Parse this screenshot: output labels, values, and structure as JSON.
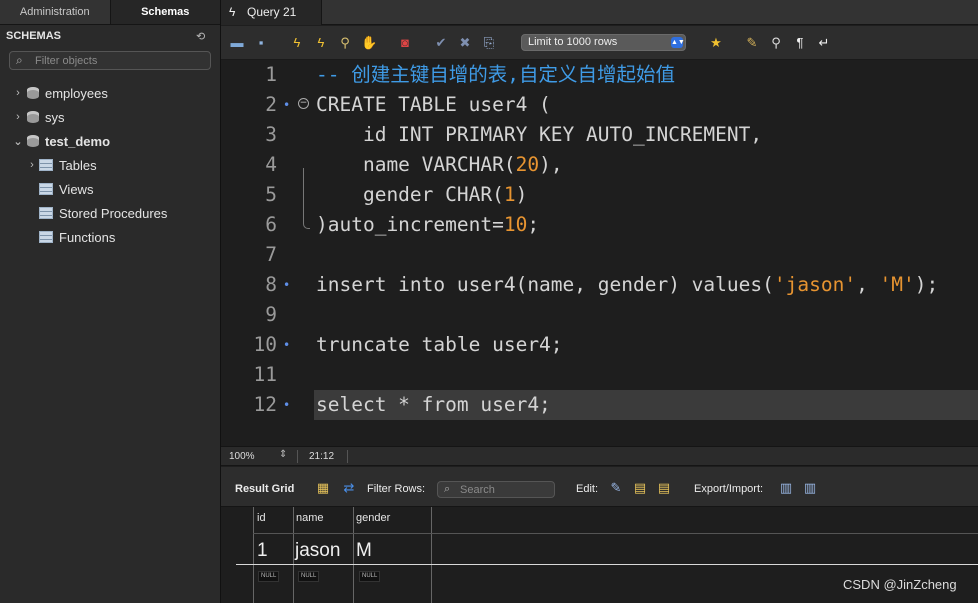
{
  "left_tabs": [
    "Administration",
    "Schemas"
  ],
  "schemas": {
    "header": "SCHEMAS",
    "filter_placeholder": "Filter objects",
    "items": [
      {
        "chevron": "›",
        "label": "employees"
      },
      {
        "chevron": "›",
        "label": "sys"
      },
      {
        "chevron": "⌄",
        "label": "test_demo"
      }
    ],
    "children": [
      {
        "chevron": "›",
        "label": "Tables"
      },
      {
        "chevron": "",
        "label": "Views"
      },
      {
        "chevron": "",
        "label": "Stored Procedures"
      },
      {
        "chevron": "",
        "label": "Functions"
      }
    ]
  },
  "query_tab": {
    "label": "Query 21"
  },
  "toolbar": {
    "limit_label": "Limit to 1000 rows",
    "icons": [
      "open-folder-icon",
      "save-icon",
      "execute-icon",
      "execute-current-icon",
      "explain-icon",
      "stop-icon",
      "toggle-error-icon",
      "commit-icon",
      "rollback-icon",
      "autocommit-icon",
      "bookmark-icon",
      "beautify-icon",
      "find-icon",
      "invisible-chars-icon",
      "wrap-icon"
    ]
  },
  "editor": {
    "lines": [
      {
        "n": "1",
        "marker": "",
        "parts": [
          {
            "t": "-- 创建主键自增的表,自定义自增起始值",
            "c": "cm"
          }
        ]
      },
      {
        "n": "2",
        "marker": "•",
        "parts": [
          {
            "t": "CREATE TABLE user4 (",
            "c": ""
          }
        ]
      },
      {
        "n": "3",
        "marker": "",
        "parts": [
          {
            "t": "    id INT PRIMARY KEY AUTO_INCREMENT,",
            "c": ""
          }
        ]
      },
      {
        "n": "4",
        "marker": "",
        "parts": [
          {
            "t": "    name VARCHAR(",
            "c": ""
          },
          {
            "t": "20",
            "c": "num"
          },
          {
            "t": "),",
            "c": ""
          }
        ]
      },
      {
        "n": "5",
        "marker": "",
        "parts": [
          {
            "t": "    gender CHAR(",
            "c": ""
          },
          {
            "t": "1",
            "c": "num"
          },
          {
            "t": ")",
            "c": ""
          }
        ]
      },
      {
        "n": "6",
        "marker": "",
        "parts": [
          {
            "t": ")auto_increment=",
            "c": ""
          },
          {
            "t": "10",
            "c": "num"
          },
          {
            "t": ";",
            "c": ""
          }
        ]
      },
      {
        "n": "7",
        "marker": "",
        "parts": []
      },
      {
        "n": "8",
        "marker": "•",
        "parts": [
          {
            "t": "insert into user4(name, gender) values(",
            "c": ""
          },
          {
            "t": "'jason'",
            "c": "str"
          },
          {
            "t": ", ",
            "c": ""
          },
          {
            "t": "'M'",
            "c": "str"
          },
          {
            "t": ");",
            "c": ""
          }
        ]
      },
      {
        "n": "9",
        "marker": "",
        "parts": []
      },
      {
        "n": "10",
        "marker": "•",
        "parts": [
          {
            "t": "truncate table user4;",
            "c": ""
          }
        ]
      },
      {
        "n": "11",
        "marker": "",
        "parts": []
      },
      {
        "n": "12",
        "marker": "•",
        "parts": [
          {
            "t": "select * from user4;",
            "c": ""
          }
        ],
        "current": true
      }
    ]
  },
  "status": {
    "zoom": "100%",
    "position": "21:12"
  },
  "result_toolbar": {
    "result_grid": "Result Grid",
    "filter_rows": "Filter Rows:",
    "search_placeholder": "Search",
    "edit": "Edit:",
    "export_import": "Export/Import:"
  },
  "grid": {
    "columns": [
      "id",
      "name",
      "gender"
    ],
    "row": [
      "1",
      "jason",
      "M"
    ],
    "null_labels": [
      "NULL",
      "NULL",
      "NULL"
    ]
  },
  "watermark": "CSDN @JinZcheng"
}
